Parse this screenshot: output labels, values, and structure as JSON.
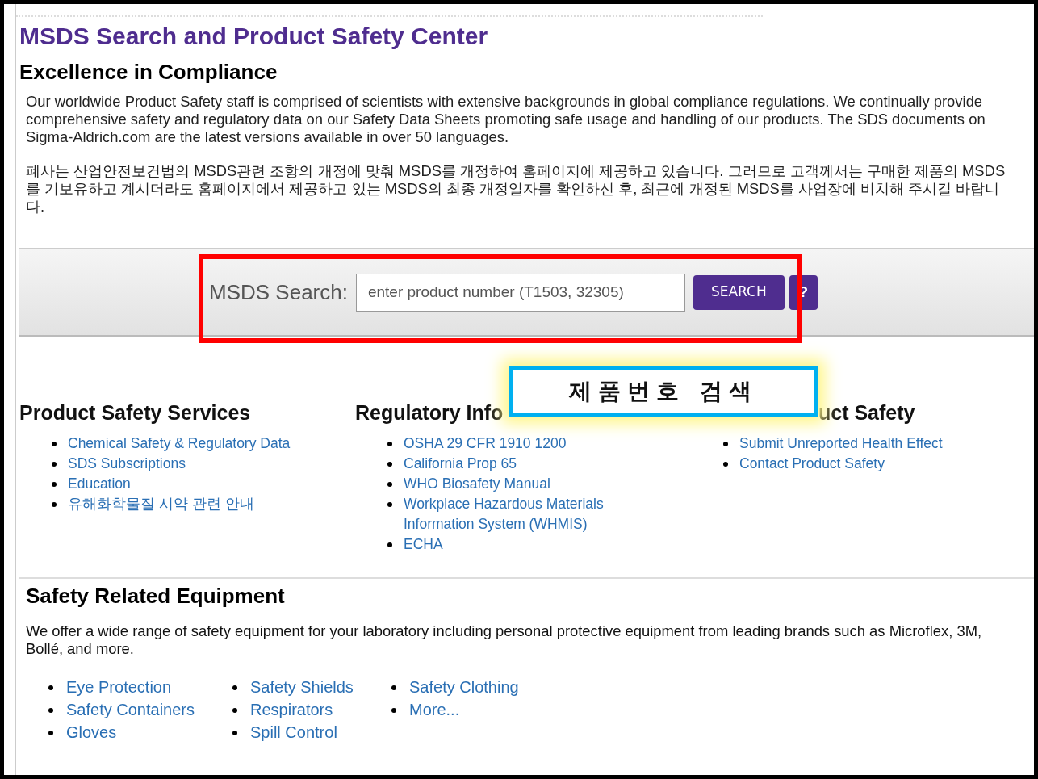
{
  "page": {
    "title": "MSDS Search and Product Safety Center",
    "subtitle": "Excellence in Compliance",
    "paragraphs": [
      "Our worldwide Product Safety staff is comprised of scientists with extensive backgrounds in global compliance regulations. We continually provide comprehensive safety and regulatory data on our Safety Data Sheets promoting safe usage and handling of our products. The SDS documents on Sigma-Aldrich.com are the latest versions available in over 50 languages.",
      "폐사는 산업안전보건법의 MSDS관련 조항의 개정에 맞춰 MSDS를 개정하여 홈페이지에 제공하고 있습니다. 그러므로 고객께서는 구매한 제품의 MSDS를 기보유하고 계시더라도 홈페이지에서 제공하고 있는 MSDS의 최종 개정일자를 확인하신 후, 최근에 개정된 MSDS를 사업장에 비치해 주시길 바랍니다."
    ]
  },
  "search": {
    "label": "MSDS Search:",
    "placeholder": "enter product number (T1503, 32305)",
    "button": "SEARCH",
    "help": "?"
  },
  "annotation": {
    "text": "제품번호 검색"
  },
  "link_columns": [
    {
      "heading": "Product Safety Services",
      "links": [
        "Chemical Safety & Regulatory Data",
        "SDS Subscriptions",
        "Education",
        "유해화학물질 시약 관련 안내"
      ]
    },
    {
      "heading": "Regulatory Info",
      "links": [
        "OSHA 29 CFR 1910 1200",
        "California Prop 65",
        "WHO Biosafety Manual",
        "Workplace Hazardous Materials Information System (WHMIS)",
        "ECHA"
      ]
    },
    {
      "heading": "uct Safety",
      "links": [
        "Submit Unreported Health Effect",
        "Contact Product Safety"
      ]
    }
  ],
  "equipment": {
    "heading": "Safety Related Equipment",
    "text": "We offer a wide range of safety equipment for your laboratory including personal protective equipment from leading brands such as Microflex, 3M, Bollé, and more.",
    "columns": [
      [
        "Eye Protection",
        "Safety Containers",
        "Gloves"
      ],
      [
        "Safety Shields",
        "Respirators",
        "Spill Control"
      ],
      [
        "Safety Clothing",
        "More..."
      ]
    ]
  }
}
